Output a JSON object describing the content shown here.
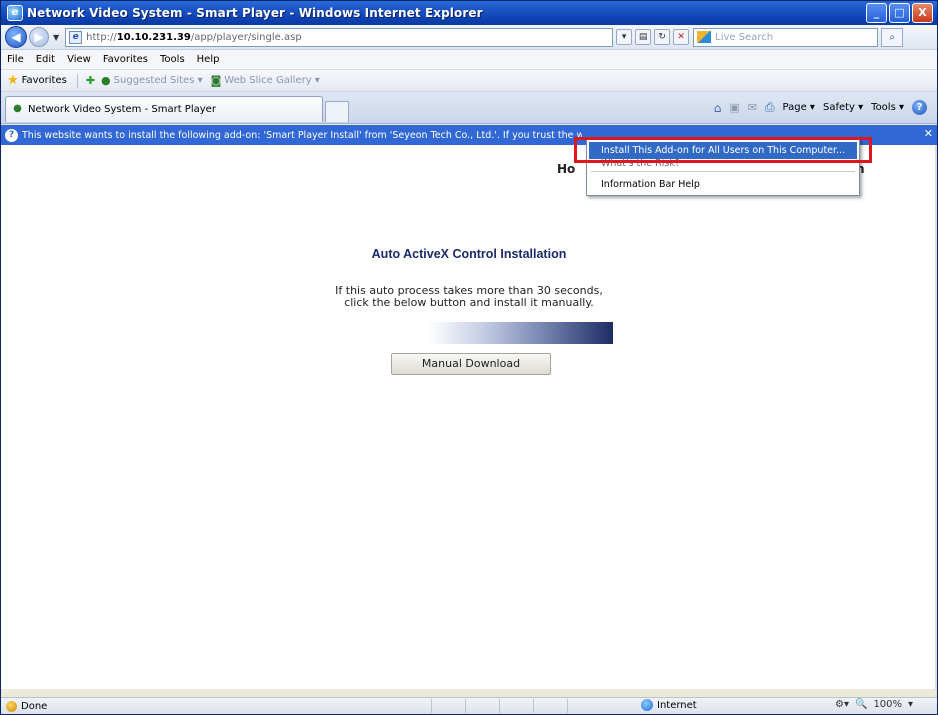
{
  "window": {
    "title": "Network Video System - Smart Player - Windows Internet Explorer",
    "controls": {
      "minimize": "_",
      "maximize": "□",
      "close": "X"
    }
  },
  "address_bar": {
    "url_prefix": "http://",
    "url_host": "10.10.231.39",
    "url_path": "/app/player/single.asp",
    "search_placeholder": "Live Search"
  },
  "menu": [
    "File",
    "Edit",
    "View",
    "Favorites",
    "Tools",
    "Help"
  ],
  "favorites_bar": {
    "label": "Favorites",
    "links": [
      "Suggested Sites ▾",
      "Web Slice Gallery ▾"
    ]
  },
  "tab": {
    "label": "Network Video System - Smart Player"
  },
  "command_bar": {
    "page": "Page ▾",
    "safety": "Safety ▾",
    "tools": "Tools ▾"
  },
  "info_bar": {
    "text": "This website wants to install the following add-on: 'Smart Player Install' from 'Seyeon Tech Co., Ltd.'. If you trust the we"
  },
  "context_menu": {
    "install": "Install This Add-on for All Users on This Computer...",
    "risk": "What's the Risk?",
    "help": "Information Bar Help"
  },
  "content": {
    "partial_left": "Ho",
    "partial_right": "n",
    "heading": "Auto ActiveX Control Installation",
    "line1": "If this auto process takes more than 30 seconds,",
    "line2": "click the below button and install it manually.",
    "button": "Manual Download"
  },
  "status_bar": {
    "text": "Done",
    "zone": "Internet",
    "zoom": "100%"
  },
  "colors": {
    "titlebar": "#0f43b4",
    "infobar": "#3168d5",
    "highlight": "#e0161e",
    "heading": "#1b2a6b"
  }
}
